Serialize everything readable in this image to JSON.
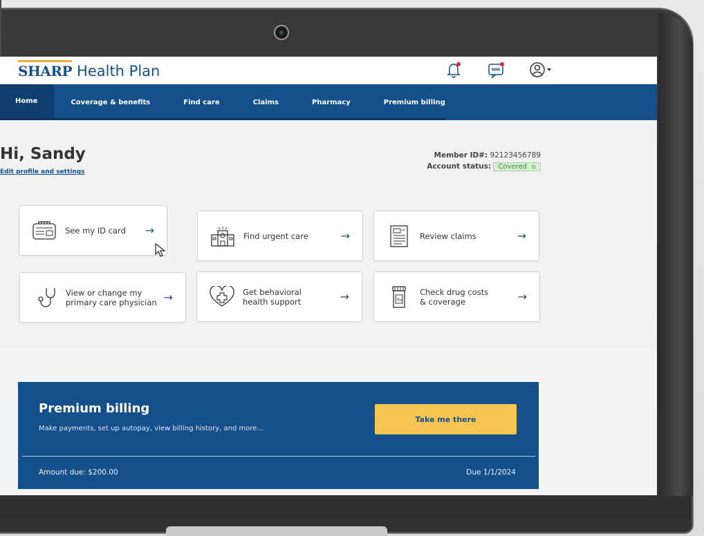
{
  "brand": {
    "sharp": "SHARP",
    "rest": "Health Plan"
  },
  "nav": {
    "items": [
      {
        "label": "Home"
      },
      {
        "label": "Coverage & benefits"
      },
      {
        "label": "Find care"
      },
      {
        "label": "Claims"
      },
      {
        "label": "Pharmacy"
      },
      {
        "label": "Premium billing"
      }
    ],
    "active": "Home"
  },
  "header_icons": [
    "bell-icon",
    "messages-icon",
    "profile-icon",
    "caret-down-icon"
  ],
  "greeting": {
    "title": "Hi, Sandy",
    "edit_link": "Edit profile and settings"
  },
  "member": {
    "id_label": "Member ID#:",
    "id_value": "92123456789",
    "status_label": "Account status:",
    "status_value": "Covered",
    "status_icon": "⊙"
  },
  "cards": [
    {
      "label": "See my ID card",
      "icon": "id-card-icon"
    },
    {
      "label": "Find urgent care",
      "icon": "hospital-icon"
    },
    {
      "label": "Review claims",
      "icon": "document-icon"
    },
    {
      "label_line1": "View or change my",
      "label_line2": "primary care physician",
      "icon": "stethoscope-icon"
    },
    {
      "label_line1": "Get behavioral",
      "label_line2": "health support",
      "icon": "heart-plus-icon"
    },
    {
      "label_line1": "Check drug costs",
      "label_line2": "& coverage",
      "icon": "pill-bottle-icon"
    }
  ],
  "billing": {
    "title": "Premium billing",
    "subtitle": "Make payments, set up autopay, view billing history, and more…",
    "button": "Take me there",
    "amount_due": "Amount due: $200.00",
    "due_date": "Due 1/1/2024"
  },
  "colors": {
    "brand_blue": "#14508c",
    "accent_yellow": "#f6c451",
    "nav_active": "#0f3e6f",
    "covered_green": "#3b8b38",
    "notification_dot": "#d8283a"
  },
  "arrow": "→"
}
